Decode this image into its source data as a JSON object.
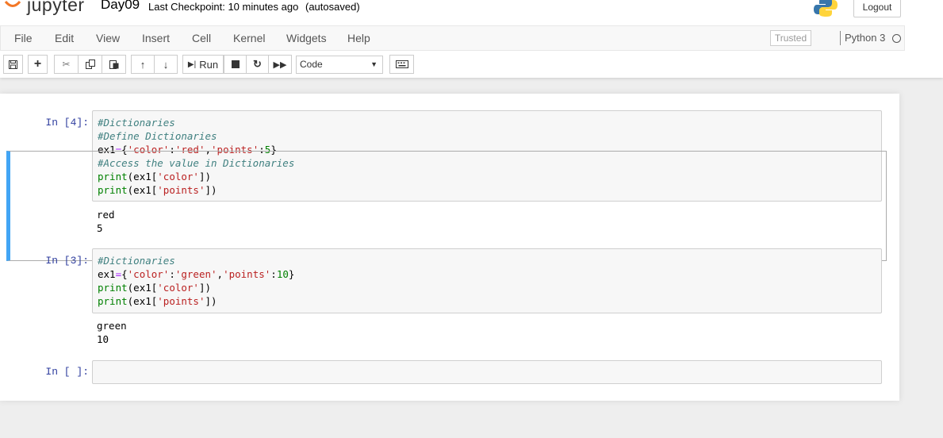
{
  "header": {
    "app_name": "jupyter",
    "notebook_name": "Day09",
    "checkpoint": "Last Checkpoint: 10 minutes ago",
    "autosave": "(autosaved)",
    "logout_label": "Logout"
  },
  "menu": {
    "items": [
      "File",
      "Edit",
      "View",
      "Insert",
      "Cell",
      "Kernel",
      "Widgets",
      "Help"
    ],
    "trusted_label": "Trusted",
    "kernel_name": "Python 3"
  },
  "toolbar": {
    "run_label": "Run",
    "cell_type": "Code"
  },
  "cells": [
    {
      "prompt": "In [4]:",
      "code": [
        "#Dictionaries",
        "#Define Dictionaries",
        "ex1={'color':'red','points':5}",
        "#Access the value in Dictionaries",
        "print(ex1['color'])",
        "print(ex1['points'])"
      ],
      "output": [
        "red",
        "5"
      ]
    },
    {
      "prompt": "In [3]:",
      "code": [
        "#Dictionaries",
        "ex1={'color':'green','points':10}",
        "print(ex1['color'])",
        "print(ex1['points'])"
      ],
      "output": [
        "green",
        "10"
      ]
    },
    {
      "prompt": "In [ ]:",
      "code": [],
      "output": []
    }
  ],
  "colors": {
    "accent_selected": "#42a5f5",
    "prompt": "#303f9f",
    "comment": "#408080",
    "string": "#ba2121",
    "number": "#008000"
  }
}
